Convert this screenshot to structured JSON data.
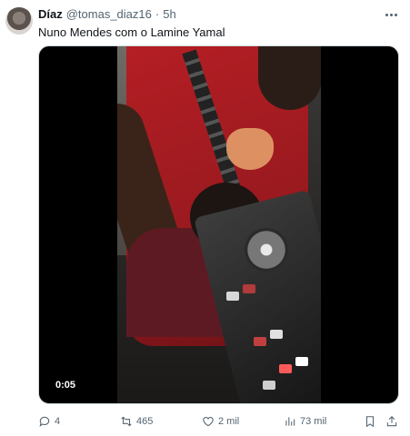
{
  "tweet": {
    "author": {
      "name": "Díaz",
      "handle": "@tomas_diaz16",
      "separator": "·",
      "time": "5h"
    },
    "text": "Nuno Mendes com o Lamine Yamal",
    "media": {
      "duration": "0:05"
    },
    "actions": {
      "replies": "4",
      "retweets": "465",
      "likes": "2 mil",
      "views": "73 mil"
    },
    "icons": {
      "more": "more-horizontal-icon",
      "reply": "reply-icon",
      "retweet": "retweet-icon",
      "like": "heart-icon",
      "views": "views-bar-chart-icon",
      "bookmark": "bookmark-icon",
      "share": "share-icon"
    },
    "colors": {
      "text": "#0f1419",
      "secondary": "#536471",
      "shirt": "#b41e24"
    }
  }
}
